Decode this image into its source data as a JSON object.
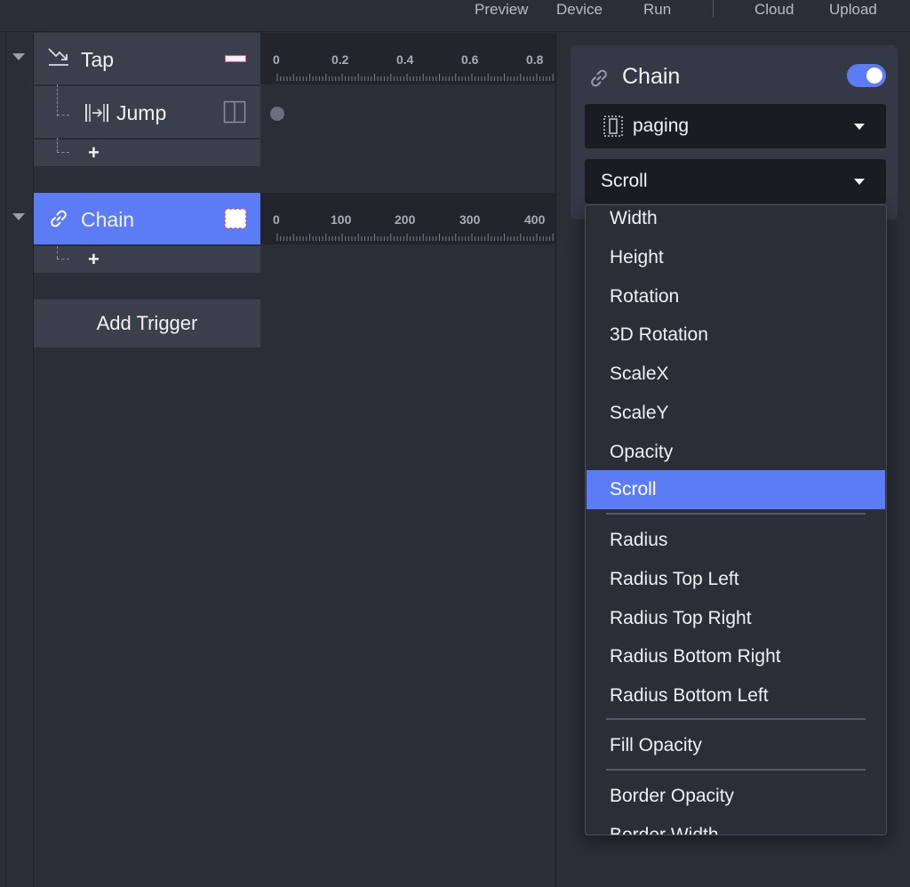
{
  "toolbar": {
    "preview": "Preview",
    "device": "Device",
    "run": "Run",
    "cloud": "Cloud",
    "upload": "Upload"
  },
  "tracks": {
    "tap": {
      "label": "Tap",
      "icon": "tap-swipe-icon"
    },
    "jump": {
      "label": "Jump",
      "icon": "jump-icon"
    },
    "chain": {
      "label": "Chain",
      "icon": "link-icon"
    },
    "add_plus": "+",
    "add_trigger": "Add Trigger"
  },
  "ruler_time": [
    "0",
    "0.2",
    "0.4",
    "0.6",
    "0.8"
  ],
  "ruler_scroll": [
    "0",
    "100",
    "200",
    "300",
    "400"
  ],
  "panel": {
    "title": "Chain",
    "toggle_on": true,
    "layer_select": "paging",
    "property_select": "Scroll"
  },
  "menu": {
    "groups": [
      [
        "Width",
        "Height",
        "Rotation",
        "3D Rotation",
        "ScaleX",
        "ScaleY",
        "Opacity",
        "Scroll"
      ],
      [
        "Radius",
        "Radius Top Left",
        "Radius Top Right",
        "Radius Bottom Right",
        "Radius Bottom Left"
      ],
      [
        "Fill Opacity"
      ],
      [
        "Border Opacity",
        "Border Width"
      ]
    ],
    "selected": "Scroll"
  },
  "colors": {
    "accent": "#5b7cf5",
    "background": "#2b2d37",
    "row": "#3b3e4b",
    "select_bg": "#1b1c22"
  }
}
